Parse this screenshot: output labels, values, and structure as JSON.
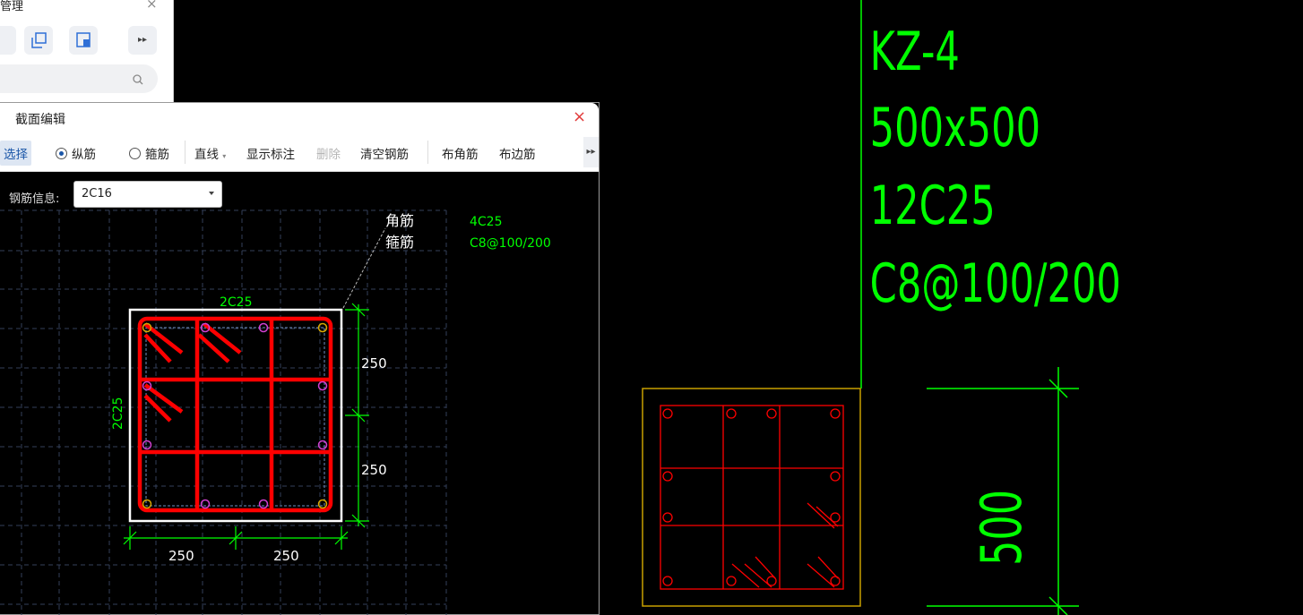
{
  "manager_panel": {
    "title": "管理",
    "close": "×",
    "more": "▸▸"
  },
  "dialog": {
    "title": "截面编辑",
    "close": "×",
    "toolbar": {
      "select": "选择",
      "longitudinal": "纵筋",
      "stirrup": "箍筋",
      "line": "直线",
      "show_annotation": "显示标注",
      "delete": "删除",
      "clear_rebar": "清空钢筋",
      "corner_rebar": "布角筋",
      "edge_rebar": "布边筋",
      "more": "▸▸"
    },
    "rebar_info_label": "钢筋信息:",
    "rebar_info_value": "2C16",
    "canvas": {
      "corner_label": "角筋",
      "stirrup_label": "箍筋",
      "corner_value": "4C25",
      "stirrup_value": "C8@100/200",
      "top_rebar": "2C25",
      "left_rebar": "2C25",
      "dim_right_1": "250",
      "dim_right_2": "250",
      "dim_bottom_1": "250",
      "dim_bottom_2": "250"
    }
  },
  "cad": {
    "name": "KZ-4",
    "size": "500x500",
    "rebar": "12C25",
    "stirrup": "C8@100/200",
    "dimension": "500"
  },
  "colors": {
    "cad_green": "#00ff00",
    "rebar_red": "#ff0000",
    "frame_yellow": "#c8a000"
  }
}
